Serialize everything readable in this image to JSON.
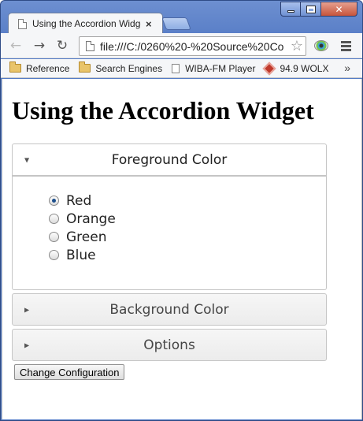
{
  "browser": {
    "tab_title": "Using the Accordion Widge",
    "tab_close_glyph": "×",
    "url": "file:///C:/0260%20-%20Source%20Co",
    "window_controls": {
      "close_glyph": "✕"
    },
    "nav": {
      "back_glyph": "←",
      "forward_glyph": "→",
      "reload_glyph": "↻",
      "star_glyph": "☆"
    },
    "bookmarks": [
      {
        "label": "Reference",
        "icon": "folder-icon"
      },
      {
        "label": "Search Engines",
        "icon": "folder-icon"
      },
      {
        "label": "WIBA-FM Player",
        "icon": "document-icon"
      },
      {
        "label": "94.9 WOLX",
        "icon": "radio-station-icon"
      }
    ],
    "bookmarks_more_glyph": "»"
  },
  "page": {
    "heading": "Using the Accordion Widget",
    "accordion": {
      "sections": [
        {
          "title": "Foreground Color",
          "expanded": true,
          "arrow_glyph": "▼",
          "options": [
            {
              "label": "Red",
              "checked": true
            },
            {
              "label": "Orange",
              "checked": false
            },
            {
              "label": "Green",
              "checked": false
            },
            {
              "label": "Blue",
              "checked": false
            }
          ]
        },
        {
          "title": "Background Color",
          "expanded": false,
          "arrow_glyph": "▶"
        },
        {
          "title": "Options",
          "expanded": false,
          "arrow_glyph": "▶"
        }
      ]
    },
    "change_button_label": "Change Configuration"
  },
  "colors": {
    "window_frame": "#5079c4",
    "close_button": "#c7543b",
    "radio_checked": "#1c4f8c"
  }
}
